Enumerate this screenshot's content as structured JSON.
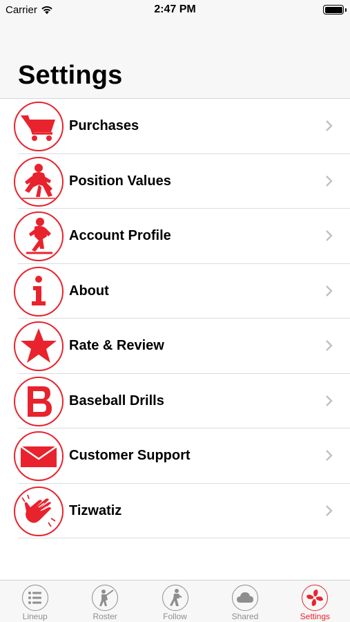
{
  "status_bar": {
    "carrier": "Carrier",
    "time": "2:47 PM"
  },
  "header": {
    "title": "Settings"
  },
  "accent_color": "#e8232d",
  "settings_items": [
    {
      "label": "Purchases",
      "icon": "shopping-cart-icon"
    },
    {
      "label": "Position Values",
      "icon": "infielder-player-icon"
    },
    {
      "label": "Account Profile",
      "icon": "pitcher-player-icon"
    },
    {
      "label": "About",
      "icon": "info-icon"
    },
    {
      "label": "Rate & Review",
      "icon": "star-icon"
    },
    {
      "label": "Baseball Drills",
      "icon": "letter-b-icon"
    },
    {
      "label": "Customer Support",
      "icon": "envelope-icon"
    },
    {
      "label": "Tizwatiz",
      "icon": "waving-hand-icon"
    }
  ],
  "tab_bar": {
    "tabs": [
      {
        "label": "Lineup",
        "icon": "list-icon",
        "active": false
      },
      {
        "label": "Roster",
        "icon": "batter-icon",
        "active": false
      },
      {
        "label": "Follow",
        "icon": "runner-icon",
        "active": false
      },
      {
        "label": "Shared",
        "icon": "cloud-icon",
        "active": false
      },
      {
        "label": "Settings",
        "icon": "settings-pinwheel-icon",
        "active": true
      }
    ]
  }
}
